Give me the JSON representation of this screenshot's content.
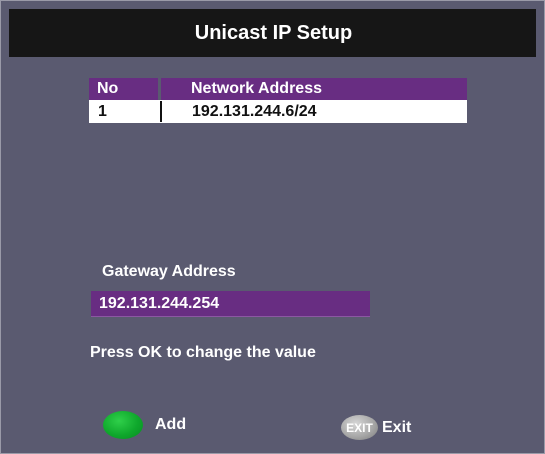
{
  "title": "Unicast IP Setup",
  "network_table": {
    "columns": [
      "No",
      "Network Address"
    ],
    "rows": [
      {
        "no": "1",
        "address": "192.131.244.6/24"
      }
    ]
  },
  "gateway": {
    "label": "Gateway Address",
    "value": "192.131.244.254"
  },
  "hint": "Press OK to change the value",
  "footer": {
    "add": {
      "icon": "green-button-icon",
      "label": "Add"
    },
    "exit": {
      "icon_text": "EXIT",
      "label": "Exit"
    }
  },
  "colors": {
    "background": "#5a5a70",
    "title_bar": "#161616",
    "highlight": "#682d82",
    "green_key": "#0fa82c"
  }
}
